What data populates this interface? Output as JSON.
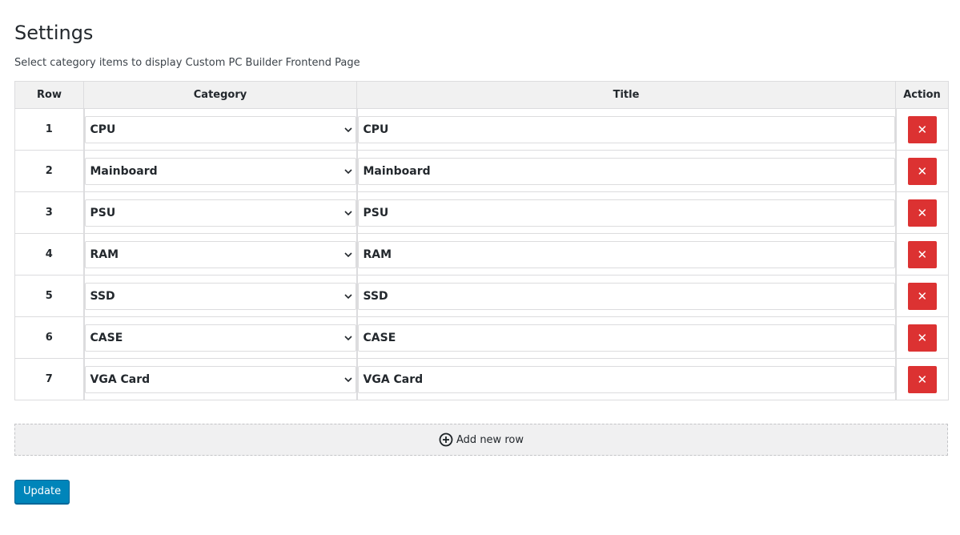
{
  "page": {
    "title": "Settings",
    "subtitle": "Select category items to display Custom PC Builder Frontend Page"
  },
  "table": {
    "headers": {
      "row": "Row",
      "category": "Category",
      "title": "Title",
      "action": "Action"
    },
    "rows": [
      {
        "num": "1",
        "category": "CPU",
        "title": "CPU"
      },
      {
        "num": "2",
        "category": "Mainboard",
        "title": "Mainboard"
      },
      {
        "num": "3",
        "category": "PSU",
        "title": "PSU"
      },
      {
        "num": "4",
        "category": "RAM",
        "title": "RAM"
      },
      {
        "num": "5",
        "category": "SSD",
        "title": "SSD"
      },
      {
        "num": "6",
        "category": "CASE",
        "title": "CASE"
      },
      {
        "num": "7",
        "category": "VGA Card",
        "title": "VGA Card"
      }
    ],
    "delete_label": "✕"
  },
  "add_row": {
    "label": "Add new row",
    "icon": "plus-circle-icon"
  },
  "update_button": {
    "label": "Update"
  },
  "colors": {
    "delete": "#dc3232",
    "primary": "#0085ba"
  }
}
